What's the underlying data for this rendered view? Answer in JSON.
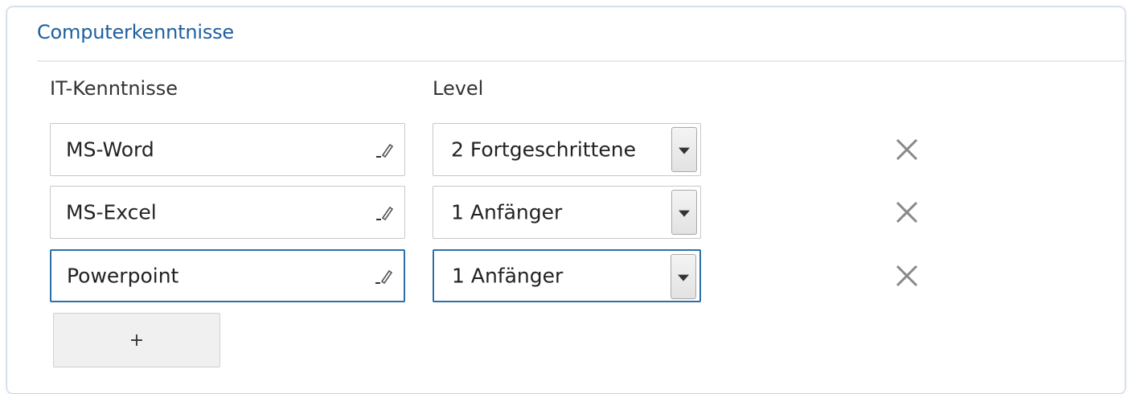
{
  "section": {
    "title": "Computerkenntnisse"
  },
  "columns": {
    "it_label": "IT-Kenntnisse",
    "level_label": "Level"
  },
  "rows": [
    {
      "skill": "MS-Word",
      "level": "2 Fortgeschrittene",
      "focused": false
    },
    {
      "skill": "MS-Excel",
      "level": "1 Anfänger",
      "focused": false
    },
    {
      "skill": "Powerpoint",
      "level": "1 Anfänger",
      "focused": true
    }
  ],
  "add_button": {
    "label": "+"
  },
  "icons": {
    "edit": "pencil-icon",
    "remove": "close-icon",
    "dropdown": "chevron-down-icon"
  },
  "colors": {
    "accent": "#1e5f9e",
    "focus_border": "#2d6fa8"
  }
}
